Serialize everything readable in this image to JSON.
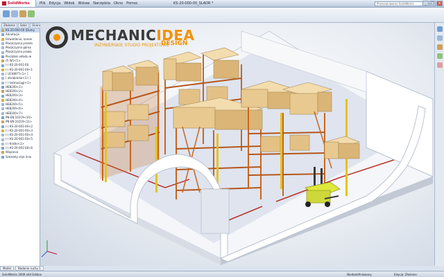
{
  "app": {
    "name": "SolidWorks",
    "document_title": "KS-20-000-00_SLADR *",
    "search_placeholder": "Przeszukiwanie SolidWorks"
  },
  "menu": [
    "Plik",
    "Edycja",
    "Widok",
    "Wstaw",
    "Narzędzia",
    "Okno",
    "Pomoc"
  ],
  "window_controls": [
    "_",
    "□",
    "×"
  ],
  "command_tabs": [
    "Złożenie",
    "Szkic",
    "Ocena"
  ],
  "tree": {
    "items": [
      "KS-20-000-00 (Domy",
      "Adnotacje",
      "Oświetlenie, kamer",
      "Płaszczyzna przedn",
      "Płaszczyzna górna",
      "Płaszczyzna prawa",
      "Początek układu w",
      "(f) W1<1>",
      "(-) KS-20-001-00",
      "(-) KS-20-001-00<1",
      "[ UCHWYT<1> ]",
      "[ obrabiarka<1> ]",
      "( ) taśmociągi<1>",
      "HEB200<1>",
      "HEB200<2>",
      "HEB200<3>",
      "HEB200<4>",
      "HEB200<5>",
      "HEB200<6>",
      "HEB200<7>",
      "PN-EN 10219<10>",
      "PN-EN 10219<11>",
      "(-) KS-20-001-00<2",
      "(-) KS-20-001-00<3",
      "(-) KS-20-001-00<4",
      "(-) KS-20-001-00<5",
      "(-) Kratki<1>",
      "(-) KS-20-001-00<6",
      "Wiązania",
      "Szkielety styk linio"
    ],
    "bottom_tabs": [
      "Model",
      "Badanie ruchu 1"
    ]
  },
  "brand": {
    "name_part1": "MECHANIC",
    "name_part2": "IDEA",
    "subtitle": "INŻYNIERSKIE STUDIO PROJEKTOWE",
    "design": "DESIGN"
  },
  "status": {
    "left": "SolidWorks 2009 x64 Edition",
    "middle": "Niedodefiniowany",
    "right": "Edycja: Złożenie"
  },
  "colors": {
    "brand_orange": "#f39200",
    "rack_orange": "#c8661c",
    "upright_yellow": "#e4c421",
    "box": "#e8c98f",
    "forklift": "#dfe83a",
    "floor_line": "#b8332a",
    "walls": "#ffffff"
  }
}
